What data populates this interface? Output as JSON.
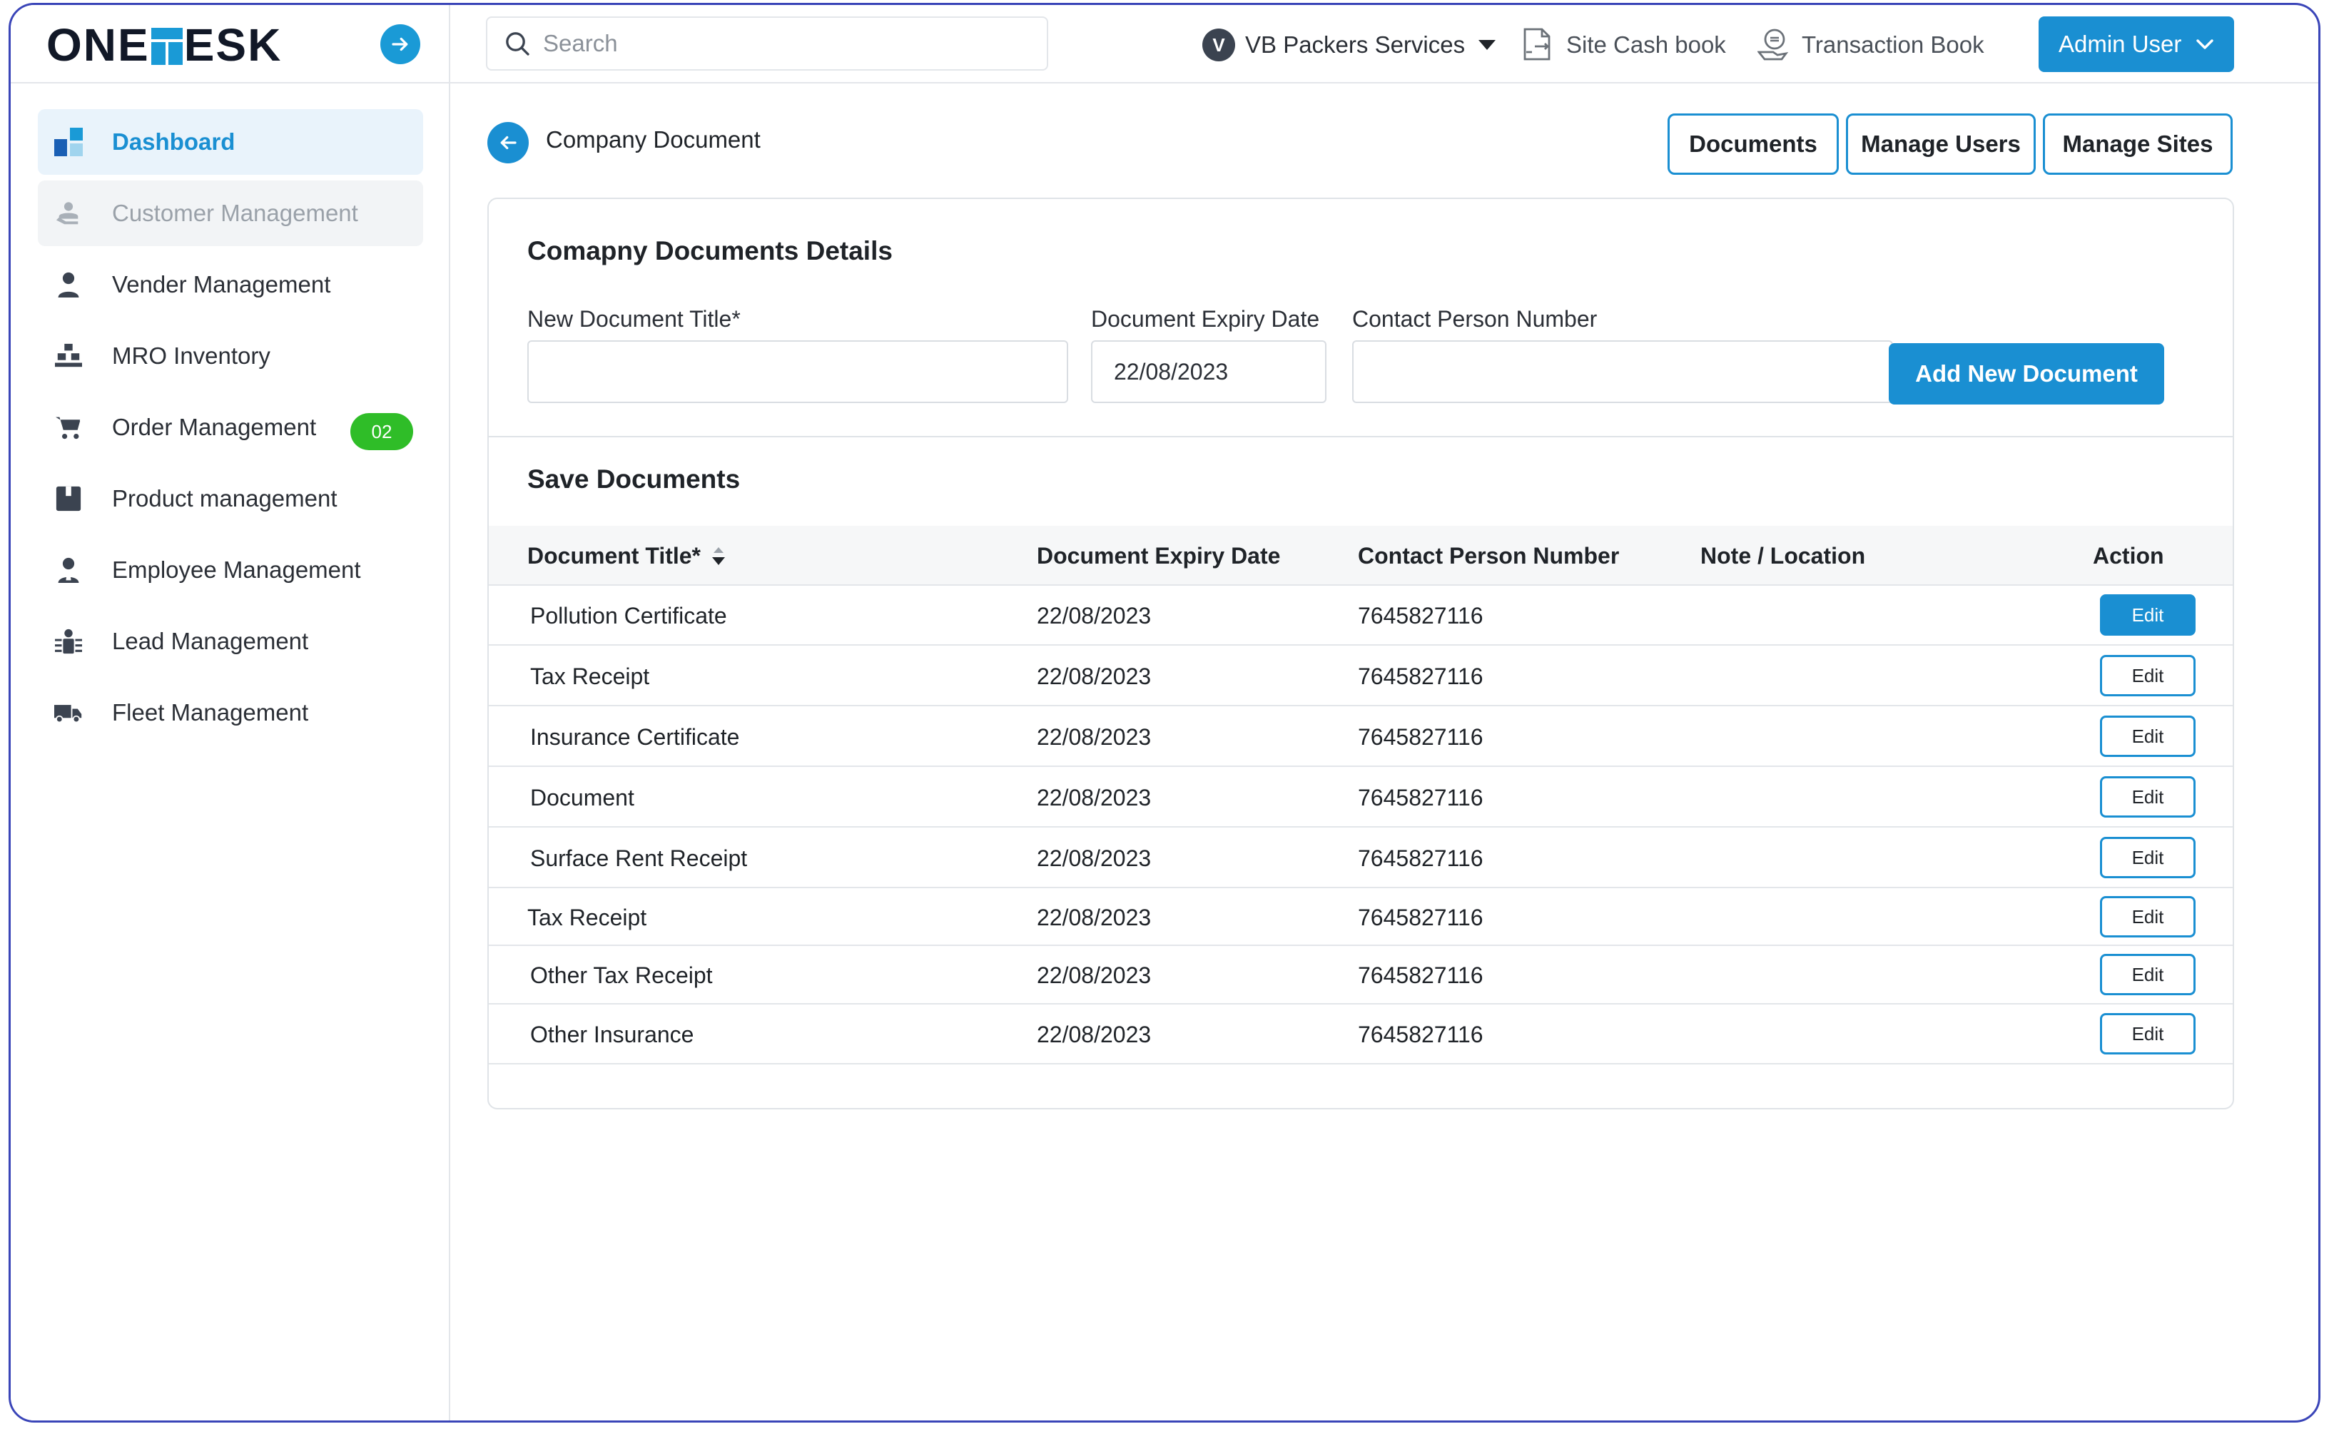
{
  "brand": {
    "logo_left": "ONE",
    "logo_right": "ESK"
  },
  "sidebar": {
    "items": [
      {
        "label": "Dashboard"
      },
      {
        "label": "Customer Management"
      },
      {
        "label": "Vender Management"
      },
      {
        "label": "MRO Inventory"
      },
      {
        "label": "Order Management",
        "badge": "02"
      },
      {
        "label": "Product management"
      },
      {
        "label": "Employee Management"
      },
      {
        "label": "Lead Management"
      },
      {
        "label": "Fleet Management"
      }
    ]
  },
  "header": {
    "search_placeholder": "Search",
    "company_initial": "V",
    "company_name": "VB Packers Services",
    "site_cash_book": "Site Cash book",
    "transaction_book": "Transaction Book",
    "admin_label": "Admin User"
  },
  "page": {
    "title": "Company Document",
    "tabs": [
      "Documents",
      "Manage Users",
      "Manage Sites"
    ]
  },
  "form": {
    "title": "Comapny Documents Details",
    "title_label": "New Document Title*",
    "title_value": "",
    "expiry_label": "Document Expiry Date",
    "expiry_value": "22/08/2023",
    "contact_label": "Contact Person Number",
    "contact_value": "",
    "add_button": "Add New Document"
  },
  "table": {
    "title": "Save Documents",
    "columns": [
      "Document Title*",
      "Document Expiry Date",
      "Contact Person Number",
      "Note / Location",
      "Action"
    ],
    "rows": [
      {
        "title": "Pollution Certificate",
        "expiry": "22/08/2023",
        "contact": "7645827116",
        "note": "",
        "action": "Edit"
      },
      {
        "title": "Tax Receipt",
        "expiry": "22/08/2023",
        "contact": "7645827116",
        "note": "",
        "action": "Edit"
      },
      {
        "title": "Insurance Certificate",
        "expiry": "22/08/2023",
        "contact": "7645827116",
        "note": "",
        "action": "Edit"
      },
      {
        "title": "Document",
        "expiry": "22/08/2023",
        "contact": "7645827116",
        "note": "",
        "action": "Edit"
      },
      {
        "title": "Surface Rent Receipt",
        "expiry": "22/08/2023",
        "contact": "7645827116",
        "note": "",
        "action": "Edit"
      },
      {
        "title": "Tax Receipt",
        "expiry": "22/08/2023",
        "contact": "7645827116",
        "note": "",
        "action": "Edit"
      },
      {
        "title": "Other Tax Receipt",
        "expiry": "22/08/2023",
        "contact": "7645827116",
        "note": "",
        "action": "Edit"
      },
      {
        "title": "Other Insurance",
        "expiry": "22/08/2023",
        "contact": "7645827116",
        "note": "",
        "action": "Edit"
      }
    ]
  },
  "colors": {
    "accent": "#1a8fd2",
    "badge": "#2fbd28",
    "frame": "#3a45b8"
  }
}
